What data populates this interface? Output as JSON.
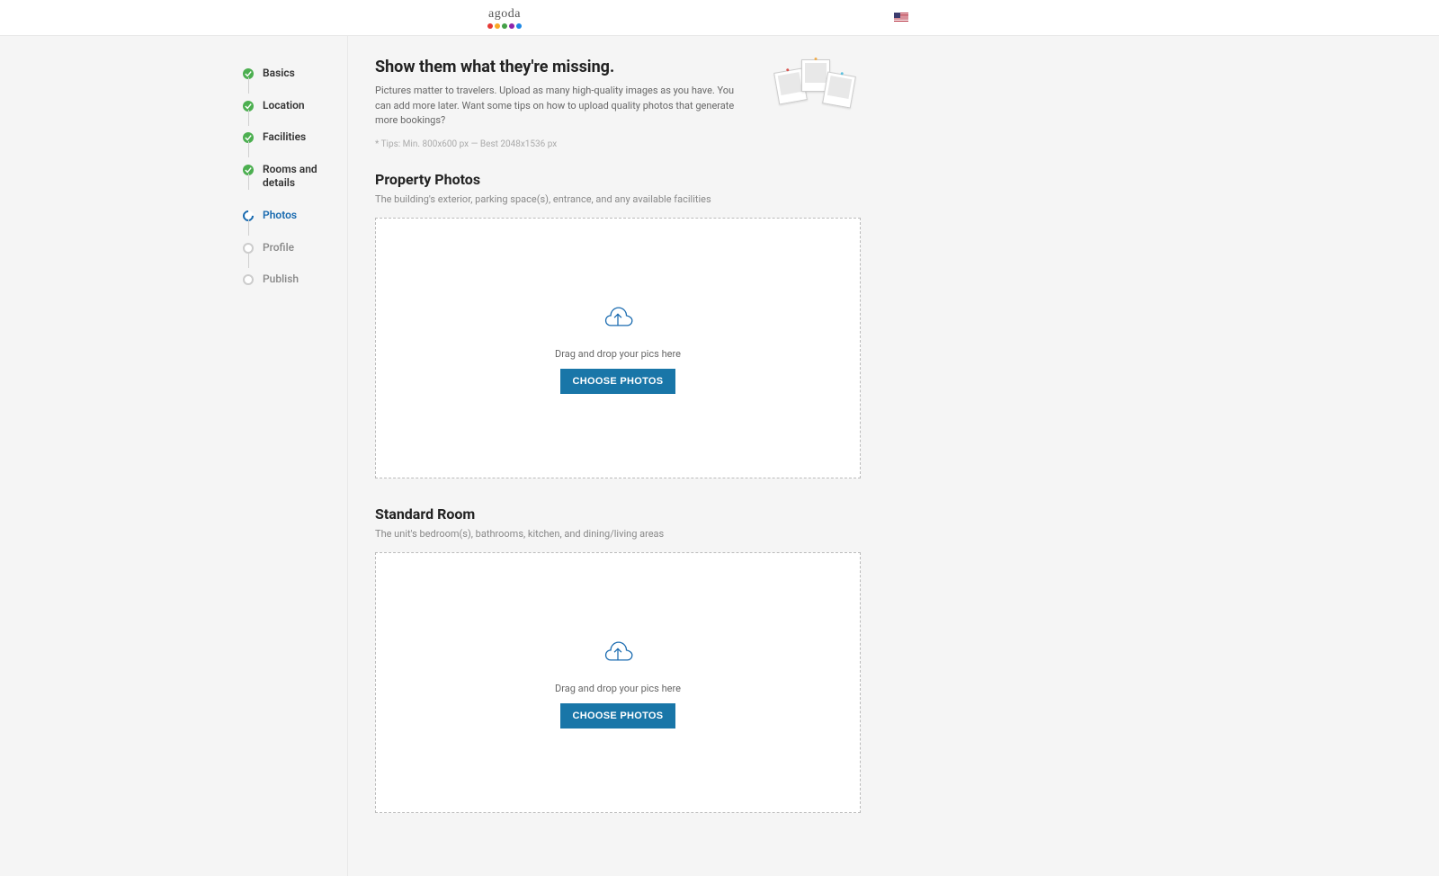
{
  "brand": {
    "name": "agoda"
  },
  "sidebar": {
    "items": [
      {
        "label": "Basics",
        "state": "done"
      },
      {
        "label": "Location",
        "state": "done"
      },
      {
        "label": "Facilities",
        "state": "done"
      },
      {
        "label": "Rooms and details",
        "state": "done"
      },
      {
        "label": "Photos",
        "state": "active"
      },
      {
        "label": "Profile",
        "state": "pending"
      },
      {
        "label": "Publish",
        "state": "pending"
      }
    ]
  },
  "hero": {
    "title": "Show them what they're missing.",
    "body": "Pictures matter to travelers. Upload as many high-quality images as you have. You can add more later. Want some tips on how to upload quality photos that generate more bookings?",
    "tips": "* Tips: Min. 800x600 px — Best 2048x1536 px"
  },
  "sections": [
    {
      "title": "Property Photos",
      "subtitle": "The building's exterior, parking space(s), entrance, and any available facilities",
      "drop_label": "Drag and drop your pics here",
      "button": "CHOOSE PHOTOS"
    },
    {
      "title": "Standard Room",
      "subtitle": "The unit's bedroom(s), bathrooms, kitchen, and dining/living areas",
      "drop_label": "Drag and drop your pics here",
      "button": "CHOOSE PHOTOS"
    }
  ],
  "colors": {
    "primary": "#1976a8",
    "success": "#4caf50",
    "dots": [
      "#e53935",
      "#f9a825",
      "#43a047",
      "#8e24aa",
      "#1e88e5"
    ]
  }
}
